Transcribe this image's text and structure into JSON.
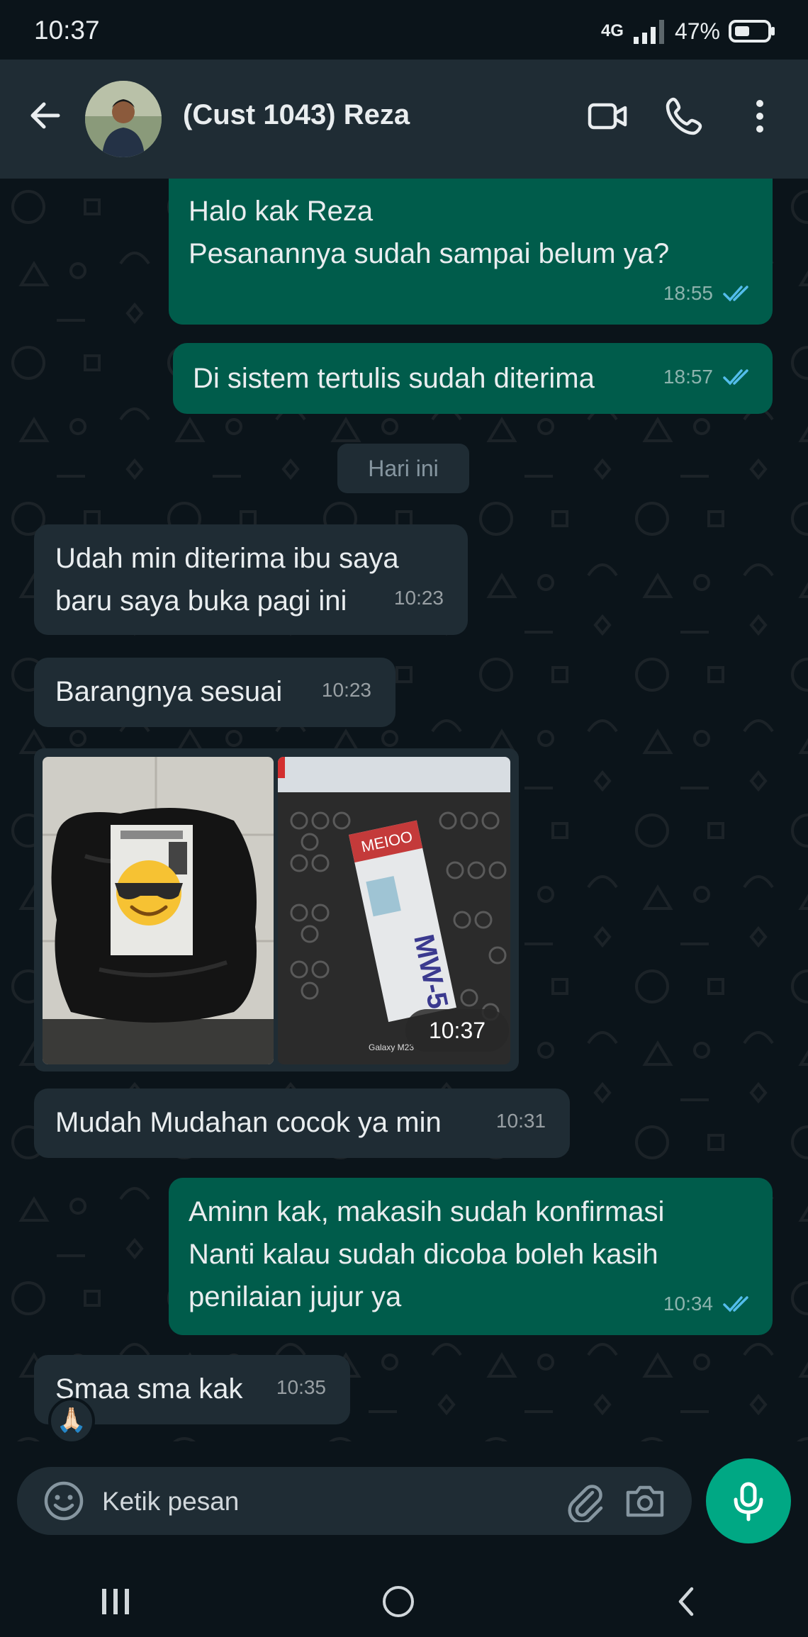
{
  "status_bar": {
    "time": "10:37",
    "network": "4G",
    "battery": "47%"
  },
  "header": {
    "contact_name": "(Cust 1043) Reza"
  },
  "messages": [
    {
      "text": "Halo kak Reza\nPesanannya sudah sampai belum ya?",
      "line1": "Halo kak Reza",
      "line2": "Pesanannya sudah sampai belum ya?",
      "time": "18:55"
    },
    {
      "text": "Di sistem tertulis sudah diterima",
      "time": "18:57"
    },
    {
      "line1": "Udah min diterima ibu saya",
      "line2": "baru saya buka pagi ini",
      "time": "10:23"
    },
    {
      "text": "Barangnya sesuai",
      "time": "10:23"
    },
    {
      "time": "10:37"
    },
    {
      "text": "Mudah Mudahan cocok ya min",
      "time": "10:31"
    },
    {
      "line1": "Aminn kak, makasih sudah konfirmasi",
      "line2": "Nanti kalau sudah dicoba boleh kasih",
      "line3": "penilaian jujur ya",
      "time": "10:34"
    },
    {
      "text": "Smaa sma kak",
      "time": "10:35",
      "reaction": "🙏🏻"
    }
  ],
  "date_divider": "Hari ini",
  "photo_sticker_text": {
    "box_brand": "MEIOO",
    "box_model": "MW-5",
    "caption_watermark": "Galaxy M23"
  },
  "input": {
    "placeholder": "Ketik pesan"
  },
  "icons": [
    "back-arrow-icon",
    "video-call-icon",
    "voice-call-icon",
    "more-vert-icon",
    "emoji-icon",
    "attach-icon",
    "camera-icon",
    "mic-icon",
    "double-check-icon",
    "recents-icon",
    "home-icon",
    "back-nav-icon"
  ],
  "colors": {
    "outgoing": "#005c4b",
    "incoming": "#1f2c34",
    "accent": "#00a884",
    "read_tick": "#53bdeb"
  }
}
